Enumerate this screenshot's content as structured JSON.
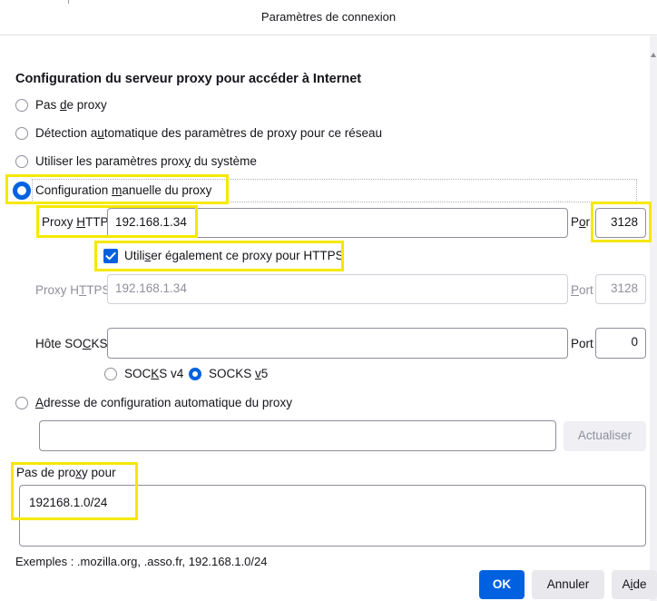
{
  "dialog": {
    "title": "Paramètres de connexion"
  },
  "section": {
    "heading": "Configuration du serveur proxy pour accéder à Internet"
  },
  "options": {
    "no_proxy": {
      "pre": "Pas ",
      "key": "d",
      "post": "e proxy"
    },
    "auto_detect": {
      "pre": "Détection a",
      "key": "u",
      "post": "tomatique des paramètres de proxy pour ce réseau"
    },
    "system": {
      "pre": "Utiliser les paramètres prox",
      "key": "y",
      "post": " du système"
    },
    "manual": {
      "pre": "Configuration ",
      "key": "m",
      "post": "anuelle du proxy"
    },
    "auto_url": {
      "pre": "",
      "key": "A",
      "post": "dresse de configuration automatique du proxy"
    }
  },
  "http": {
    "label_pre": "Proxy ",
    "label_key": "H",
    "label_post": "TTP",
    "value": "192.168.1.34",
    "port_label_pre": "P",
    "port_label_key": "o",
    "port_label_post": "r",
    "port": "3128"
  },
  "https_checkbox": {
    "pre": "Utili",
    "key": "s",
    "post": "er également ce proxy pour HTTPS",
    "checked": true
  },
  "https": {
    "label_pre": "Proxy H",
    "label_key": "T",
    "label_post": "TPS",
    "value": "192.168.1.34",
    "port_label_pre": "",
    "port_label_key": "P",
    "port_label_post": "ort",
    "port": "3128"
  },
  "socks": {
    "label_pre": "Hôte SO",
    "label_key": "C",
    "label_post": "KS",
    "value": "",
    "port_label_pre": "Port",
    "port": "0",
    "v4_pre": "SOC",
    "v4_key": "K",
    "v4_post": "S v4",
    "v5_pre": "SOCKS ",
    "v5_key": "v",
    "v5_post": "5",
    "selected": "SOCKS v5"
  },
  "auto_config": {
    "url": "",
    "reload_label": "Actualiser"
  },
  "no_proxy_for": {
    "label_pre": "Pas de pro",
    "label_key": "x",
    "label_post": "y pour",
    "value": "192168.1.0/24"
  },
  "examples": "Exemples : .mozilla.org, .asso.fr, 192.168.1.0/24",
  "buttons": {
    "ok": "OK",
    "cancel": "Annuler",
    "help_pre": "A",
    "help_key": "i",
    "help_post": "de"
  },
  "colors": {
    "accent": "#0061e0",
    "highlight": "#f5e800"
  }
}
